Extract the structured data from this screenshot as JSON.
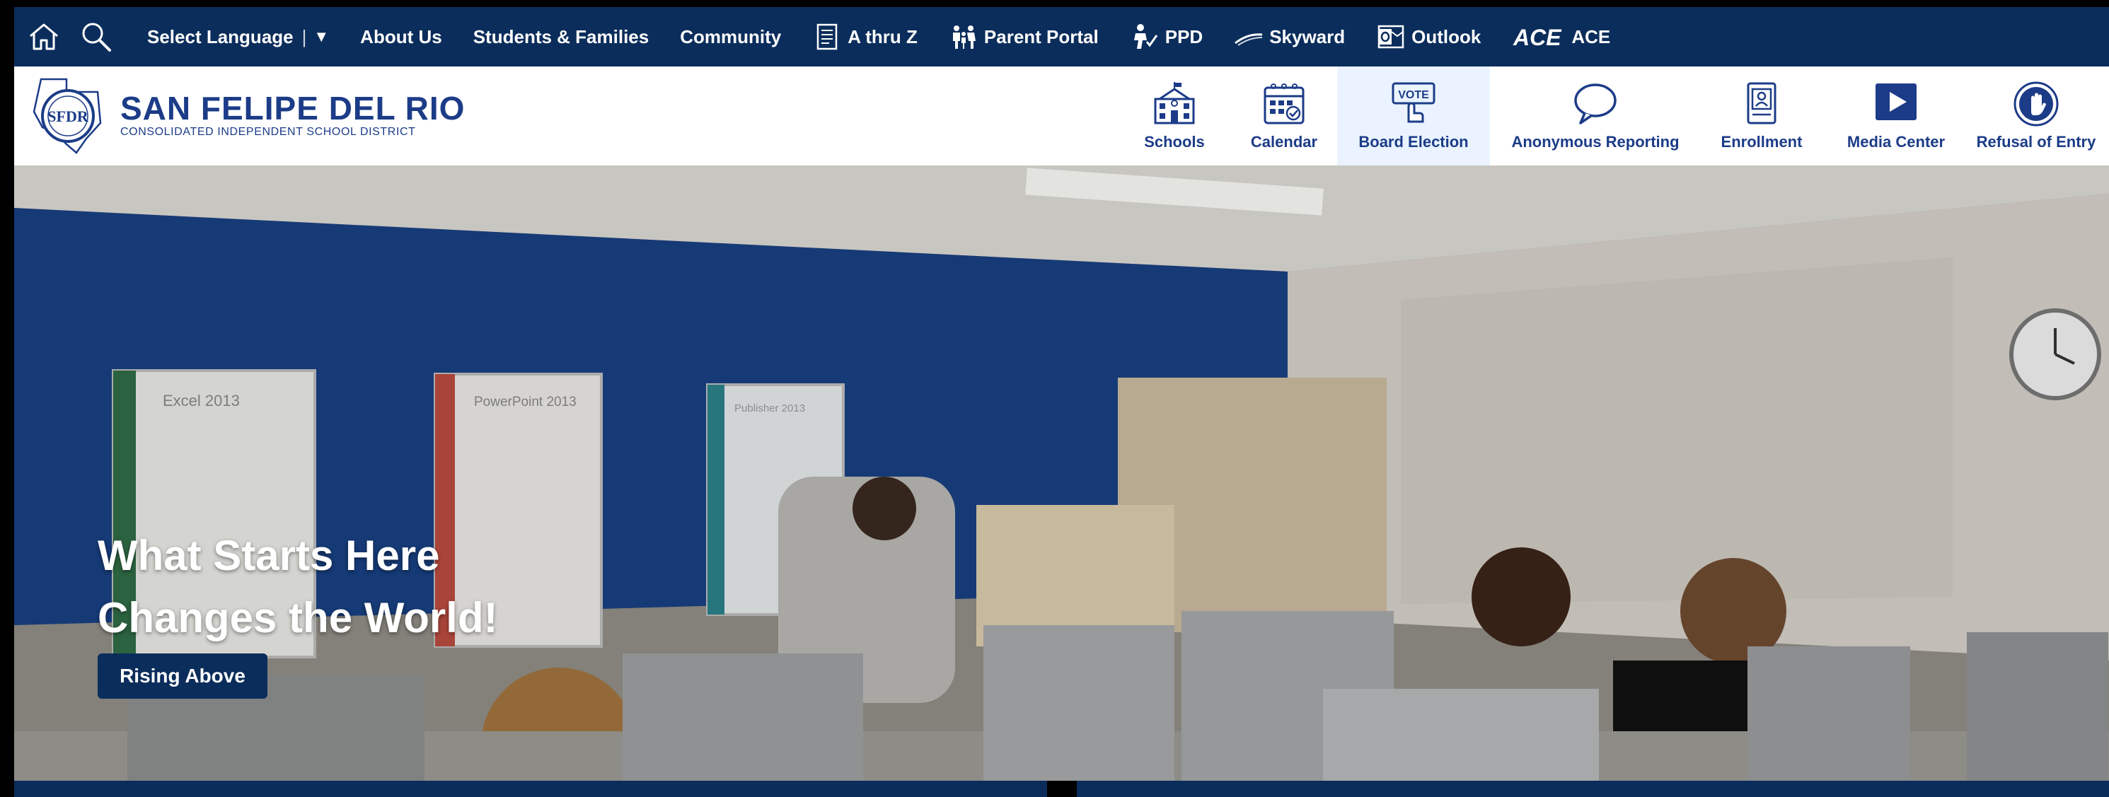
{
  "topnav": {
    "home_icon": "home-icon",
    "search_icon": "search-icon",
    "language": {
      "label": "Select Language",
      "separator": "|",
      "arrow": "▼"
    },
    "items": [
      {
        "label": "About Us"
      },
      {
        "label": "Students & Families"
      },
      {
        "label": "Community"
      },
      {
        "label": "A thru Z",
        "icon": "list-document-icon"
      },
      {
        "label": "Parent Portal",
        "icon": "family-icon"
      },
      {
        "label": "PPD",
        "icon": "person-check-icon"
      },
      {
        "label": "Skyward",
        "icon": "swoosh-icon"
      },
      {
        "label": "Outlook",
        "icon": "outlook-icon"
      },
      {
        "label": "ACE",
        "icon": "ace-logo-icon"
      }
    ]
  },
  "header": {
    "logo": {
      "seal_text": "SFDR",
      "title": "SAN FELIPE DEL RIO",
      "subtitle": "CONSOLIDATED INDEPENDENT SCHOOL DISTRICT"
    },
    "quicklinks": [
      {
        "label": "Schools",
        "icon": "school-building-icon"
      },
      {
        "label": "Calendar",
        "icon": "calendar-icon"
      },
      {
        "label": "Board Election",
        "icon": "vote-icon",
        "vote_text": "VOTE"
      },
      {
        "label": "Anonymous Reporting",
        "icon": "speech-bubble-icon"
      },
      {
        "label": "Enrollment",
        "icon": "enrollment-document-icon"
      },
      {
        "label": "Media Center",
        "icon": "play-icon"
      },
      {
        "label": "Refusal of Entry",
        "icon": "hand-stop-icon"
      }
    ]
  },
  "hero": {
    "headline_line1": "What Starts Here",
    "headline_line2": "Changes the World!",
    "button_label": "Rising Above",
    "posters": [
      "Excel 2013",
      "PowerPoint 2013",
      "Publisher 2013"
    ]
  },
  "colors": {
    "navy": "#0b2d5b",
    "brand_blue": "#1c3c88",
    "active_tile": "#eaf3ff"
  }
}
